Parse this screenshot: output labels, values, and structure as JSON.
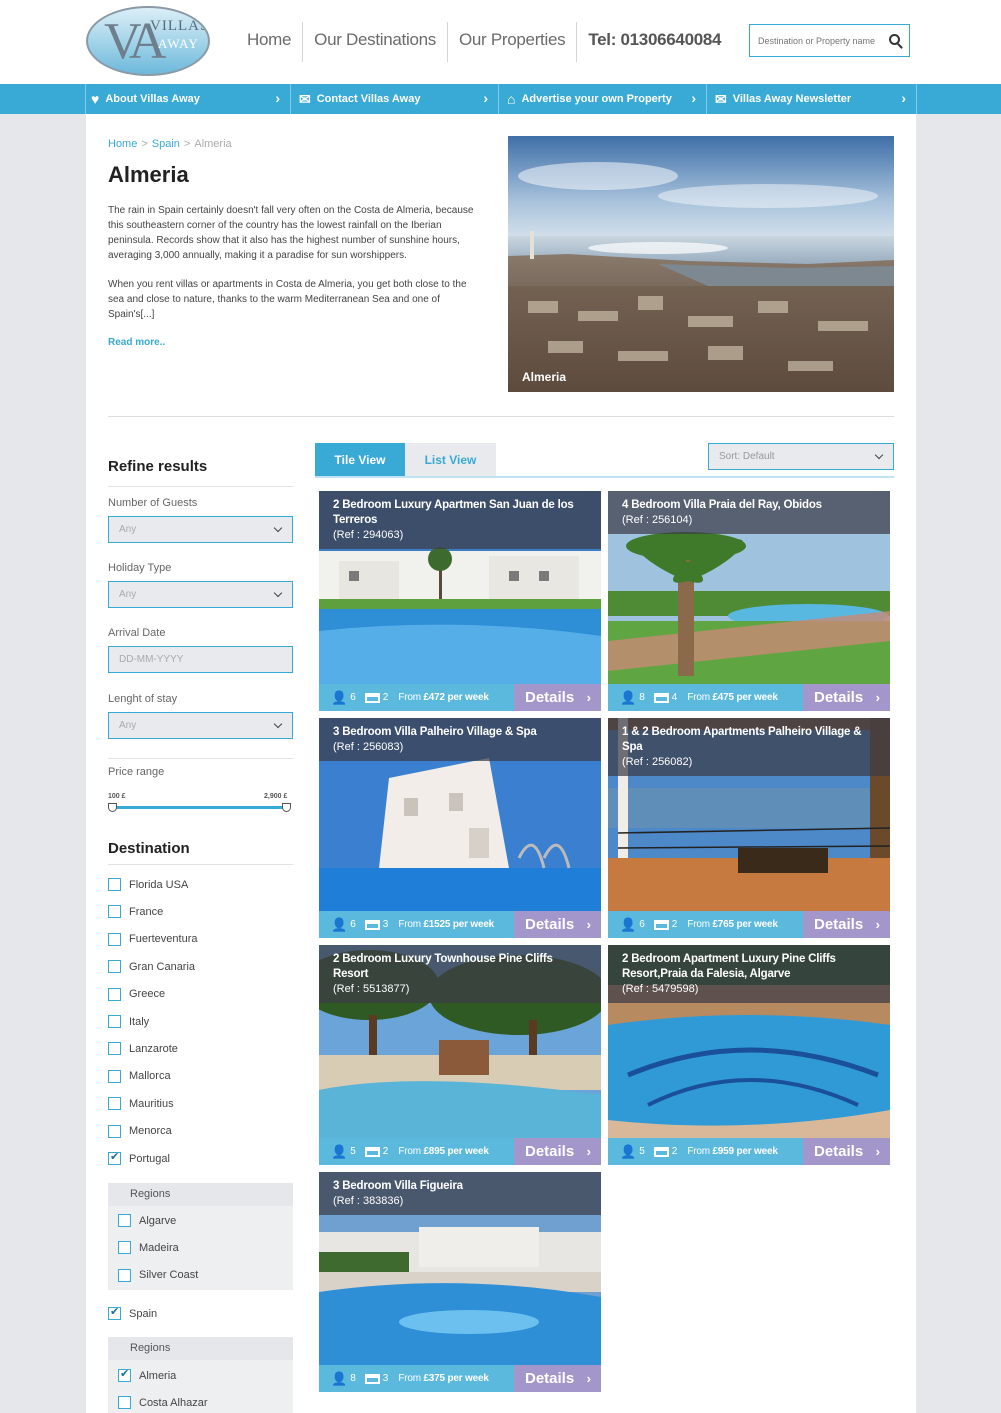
{
  "header": {
    "logo": {
      "big": "VA",
      "line1": "VILLAS",
      "line2": "AWAY"
    },
    "nav": [
      "Home",
      "Our Destinations",
      "Our Properties",
      "Tel: 01306640084"
    ],
    "search_placeholder": "Destination or Property name"
  },
  "bluebar": [
    {
      "label": "About Villas Away",
      "icon": "heart-icon"
    },
    {
      "label": "Contact Villas Away",
      "icon": "chat-icon"
    },
    {
      "label": "Advertise your own Property",
      "icon": "house-icon"
    },
    {
      "label": "Villas Away Newsletter",
      "icon": "mail-icon"
    }
  ],
  "breadcrumb": [
    "Home",
    "Spain",
    "Almeria"
  ],
  "page": {
    "title": "Almeria",
    "intro_p1": "The rain in Spain certainly doesn't fall very often on the Costa de Almeria, because this southeastern corner of the country has the lowest rainfall on the Iberian peninsula. Records show that it also has the highest number of sunshine hours, averaging 3,000 annually, making it a paradise for sun worshippers.",
    "intro_p2": " When you rent villas or apartments in Costa de Almeria, you get both close to the sea and close to nature, thanks to the warm Mediterranean Sea and one of Spain's[...]",
    "read_more": "Read more..",
    "hero_caption": "Almeria"
  },
  "filters": {
    "title": "Refine results",
    "guests_label": "Number of Guests",
    "guests_value": "Any",
    "holiday_label": "Holiday Type",
    "holiday_value": "Any",
    "arrival_label": "Arrival Date",
    "arrival_placeholder": "DD-MM-YYYY",
    "stay_label": "Lenght of stay",
    "stay_value": "Any",
    "price_label": "Price range",
    "price_min": "100 £",
    "price_max": "2,900 £",
    "price_min_value": 100,
    "price_max_value": 2900
  },
  "destination": {
    "title": "Destination",
    "items": [
      {
        "label": "Florida USA",
        "checked": false
      },
      {
        "label": "France",
        "checked": false
      },
      {
        "label": "Fuerteventura",
        "checked": false
      },
      {
        "label": "Gran Canaria",
        "checked": false
      },
      {
        "label": "Greece",
        "checked": false
      },
      {
        "label": "Italy",
        "checked": false
      },
      {
        "label": "Lanzarote",
        "checked": false
      },
      {
        "label": "Mallorca",
        "checked": false
      },
      {
        "label": "Mauritius",
        "checked": false
      },
      {
        "label": "Menorca",
        "checked": false
      },
      {
        "label": "Portugal",
        "checked": true
      }
    ],
    "portugal_regions_title": "Regions",
    "portugal_regions": [
      {
        "label": "Algarve",
        "checked": false
      },
      {
        "label": "Madeira",
        "checked": false
      },
      {
        "label": "Silver Coast",
        "checked": false
      }
    ],
    "spain": {
      "label": "Spain",
      "checked": true
    },
    "spain_regions_title": "Regions",
    "spain_regions": [
      {
        "label": "Almeria",
        "checked": true
      },
      {
        "label": "Costa Alhazar",
        "checked": false
      }
    ]
  },
  "view": {
    "tile": "Tile View",
    "list": "List View",
    "sort": "Sort: Default"
  },
  "details_label": "Details",
  "price_prefix": "From",
  "price_suffix": "per week",
  "properties": [
    {
      "title": "2 Bedroom Luxury Apartmen San Juan de los Terreros",
      "ref": "(Ref : 294063)",
      "guests": "6",
      "beds": "2",
      "price": "£472",
      "scene": "pool-apartments"
    },
    {
      "title": "4 Bedroom Villa Praia del Ray, Obidos",
      "ref": "(Ref : 256104)",
      "guests": "8",
      "beds": "4",
      "price": "£475",
      "scene": "palm-pool"
    },
    {
      "title": "3 Bedroom Villa Palheiro Village & Spa",
      "ref": "(Ref : 256083)",
      "guests": "6",
      "beds": "3",
      "price": "£1525",
      "scene": "white-villa"
    },
    {
      "title": "1 & 2 Bedroom Apartments Palheiro Village & Spa",
      "ref": "(Ref : 256082)",
      "guests": "6",
      "beds": "2",
      "price": "£765",
      "scene": "terrace"
    },
    {
      "title": "2 Bedroom Luxury Townhouse Pine Cliffs Resort",
      "ref": "(Ref : 5513877)",
      "guests": "5",
      "beds": "2",
      "price": "£895",
      "scene": "pine-pool"
    },
    {
      "title": "2 Bedroom Apartment Luxury Pine Cliffs Resort,Praia da Falesia, Algarve",
      "ref": "(Ref : 5479598)",
      "guests": "5",
      "beds": "2",
      "price": "£959",
      "scene": "mosaic-pool"
    },
    {
      "title": "3 Bedroom Villa Figueira",
      "ref": "(Ref : 383836)",
      "guests": "8",
      "beds": "3",
      "price": "£375",
      "scene": "garden-pool"
    }
  ]
}
